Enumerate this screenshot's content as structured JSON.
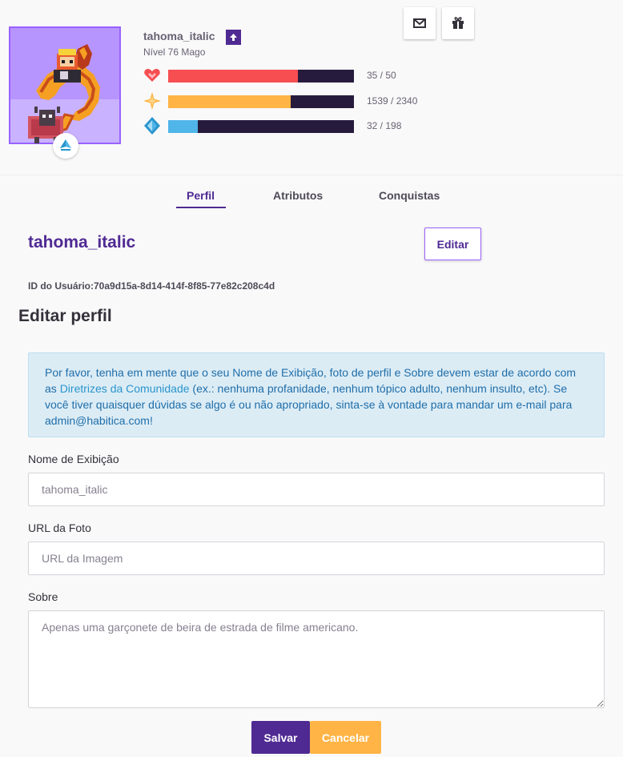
{
  "header": {
    "username": "tahoma_italic",
    "level_text": "Nível 76 Mago",
    "avatar_icon": "avatar-sprite",
    "class_badge_icon": "mage-class-icon",
    "stats": [
      {
        "name": "health",
        "icon": "heart-icon",
        "value": 35,
        "max": 50,
        "text": "35 / 50",
        "color": "#f74e52"
      },
      {
        "name": "experience",
        "icon": "star-icon",
        "value": 1539,
        "max": 2340,
        "text": "1539 / 2340",
        "color": "#ffb445"
      },
      {
        "name": "mana",
        "icon": "diamond-icon",
        "value": 32,
        "max": 198,
        "text": "32 / 198",
        "color": "#50b5e9"
      }
    ],
    "buttons": [
      {
        "name": "message-button",
        "icon": "envelope-icon"
      },
      {
        "name": "gift-button",
        "icon": "gift-icon"
      }
    ]
  },
  "tabs": [
    {
      "label": "Perfil",
      "active": true
    },
    {
      "label": "Atributos",
      "active": false
    },
    {
      "label": "Conquistas",
      "active": false
    }
  ],
  "profile": {
    "display_name": "tahoma_italic",
    "edit_label": "Editar",
    "user_id_text": "ID do Usuário:70a9d15a-8d14-414f-8f85-77e82c208c4d"
  },
  "edit_profile": {
    "title": "Editar perfil",
    "alert": {
      "text_before": "Por favor, tenha em mente que o seu Nome de Exibição, foto de perfil e Sobre devem estar de acordo com as ",
      "link_text": "Diretrizes da Comunidade",
      "text_after": " (ex.: nenhuma profanidade, nenhum tópico adulto, nenhum insulto, etc). Se você tiver quaisquer dúvidas se algo é ou não apropriado, sinta-se à vontade para mandar um e-mail para ",
      "email": "admin@habitica.com",
      "text_end": "!"
    },
    "display_name_label": "Nome de Exibição",
    "display_name_value": "",
    "display_name_placeholder": "tahoma_italic",
    "photo_label": "URL da Foto",
    "photo_value": "",
    "photo_placeholder": "URL da Imagem",
    "about_label": "Sobre",
    "about_value": "",
    "about_placeholder": "Apenas uma garçonete de beira de estrada de filme americano.",
    "save_label": "Salvar",
    "cancel_label": "Cancelar"
  },
  "colors": {
    "brand_purple": "#4f2a93",
    "accent_purple": "#9a62ff",
    "health_red": "#f74e52",
    "exp_yellow": "#ffb445",
    "mana_blue": "#50b5e9",
    "bar_bg": "#271b3d"
  }
}
